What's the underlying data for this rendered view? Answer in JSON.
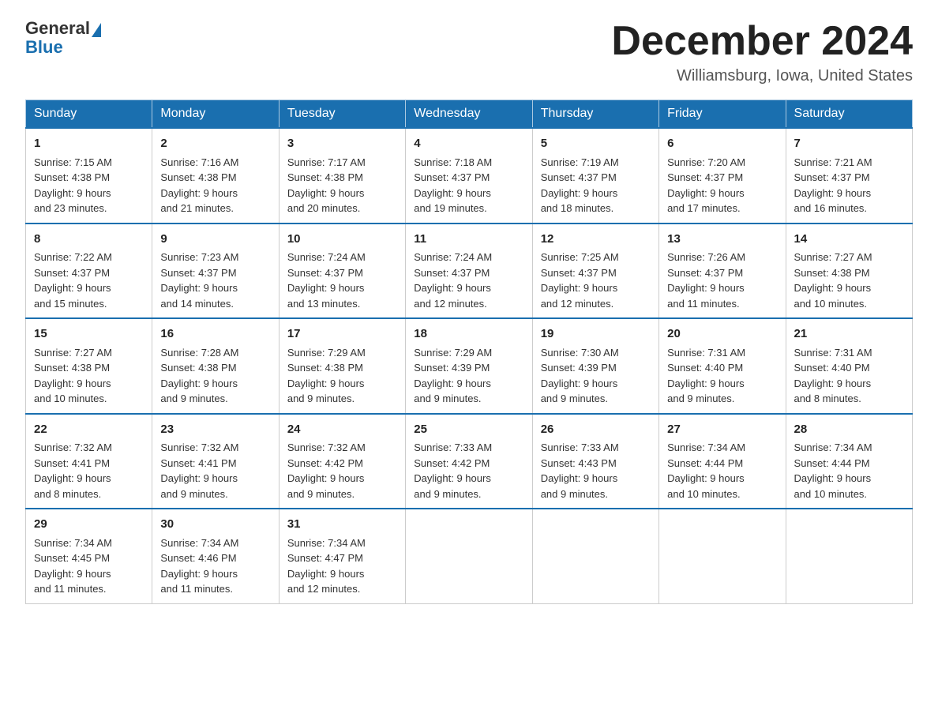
{
  "logo": {
    "general": "General",
    "blue": "Blue"
  },
  "header": {
    "month_year": "December 2024",
    "location": "Williamsburg, Iowa, United States"
  },
  "weekdays": [
    "Sunday",
    "Monday",
    "Tuesday",
    "Wednesday",
    "Thursday",
    "Friday",
    "Saturday"
  ],
  "weeks": [
    [
      {
        "day": "1",
        "sunrise": "7:15 AM",
        "sunset": "4:38 PM",
        "daylight": "9 hours and 23 minutes."
      },
      {
        "day": "2",
        "sunrise": "7:16 AM",
        "sunset": "4:38 PM",
        "daylight": "9 hours and 21 minutes."
      },
      {
        "day": "3",
        "sunrise": "7:17 AM",
        "sunset": "4:38 PM",
        "daylight": "9 hours and 20 minutes."
      },
      {
        "day": "4",
        "sunrise": "7:18 AM",
        "sunset": "4:37 PM",
        "daylight": "9 hours and 19 minutes."
      },
      {
        "day": "5",
        "sunrise": "7:19 AM",
        "sunset": "4:37 PM",
        "daylight": "9 hours and 18 minutes."
      },
      {
        "day": "6",
        "sunrise": "7:20 AM",
        "sunset": "4:37 PM",
        "daylight": "9 hours and 17 minutes."
      },
      {
        "day": "7",
        "sunrise": "7:21 AM",
        "sunset": "4:37 PM",
        "daylight": "9 hours and 16 minutes."
      }
    ],
    [
      {
        "day": "8",
        "sunrise": "7:22 AM",
        "sunset": "4:37 PM",
        "daylight": "9 hours and 15 minutes."
      },
      {
        "day": "9",
        "sunrise": "7:23 AM",
        "sunset": "4:37 PM",
        "daylight": "9 hours and 14 minutes."
      },
      {
        "day": "10",
        "sunrise": "7:24 AM",
        "sunset": "4:37 PM",
        "daylight": "9 hours and 13 minutes."
      },
      {
        "day": "11",
        "sunrise": "7:24 AM",
        "sunset": "4:37 PM",
        "daylight": "9 hours and 12 minutes."
      },
      {
        "day": "12",
        "sunrise": "7:25 AM",
        "sunset": "4:37 PM",
        "daylight": "9 hours and 12 minutes."
      },
      {
        "day": "13",
        "sunrise": "7:26 AM",
        "sunset": "4:37 PM",
        "daylight": "9 hours and 11 minutes."
      },
      {
        "day": "14",
        "sunrise": "7:27 AM",
        "sunset": "4:38 PM",
        "daylight": "9 hours and 10 minutes."
      }
    ],
    [
      {
        "day": "15",
        "sunrise": "7:27 AM",
        "sunset": "4:38 PM",
        "daylight": "9 hours and 10 minutes."
      },
      {
        "day": "16",
        "sunrise": "7:28 AM",
        "sunset": "4:38 PM",
        "daylight": "9 hours and 9 minutes."
      },
      {
        "day": "17",
        "sunrise": "7:29 AM",
        "sunset": "4:38 PM",
        "daylight": "9 hours and 9 minutes."
      },
      {
        "day": "18",
        "sunrise": "7:29 AM",
        "sunset": "4:39 PM",
        "daylight": "9 hours and 9 minutes."
      },
      {
        "day": "19",
        "sunrise": "7:30 AM",
        "sunset": "4:39 PM",
        "daylight": "9 hours and 9 minutes."
      },
      {
        "day": "20",
        "sunrise": "7:31 AM",
        "sunset": "4:40 PM",
        "daylight": "9 hours and 9 minutes."
      },
      {
        "day": "21",
        "sunrise": "7:31 AM",
        "sunset": "4:40 PM",
        "daylight": "9 hours and 8 minutes."
      }
    ],
    [
      {
        "day": "22",
        "sunrise": "7:32 AM",
        "sunset": "4:41 PM",
        "daylight": "9 hours and 8 minutes."
      },
      {
        "day": "23",
        "sunrise": "7:32 AM",
        "sunset": "4:41 PM",
        "daylight": "9 hours and 9 minutes."
      },
      {
        "day": "24",
        "sunrise": "7:32 AM",
        "sunset": "4:42 PM",
        "daylight": "9 hours and 9 minutes."
      },
      {
        "day": "25",
        "sunrise": "7:33 AM",
        "sunset": "4:42 PM",
        "daylight": "9 hours and 9 minutes."
      },
      {
        "day": "26",
        "sunrise": "7:33 AM",
        "sunset": "4:43 PM",
        "daylight": "9 hours and 9 minutes."
      },
      {
        "day": "27",
        "sunrise": "7:34 AM",
        "sunset": "4:44 PM",
        "daylight": "9 hours and 10 minutes."
      },
      {
        "day": "28",
        "sunrise": "7:34 AM",
        "sunset": "4:44 PM",
        "daylight": "9 hours and 10 minutes."
      }
    ],
    [
      {
        "day": "29",
        "sunrise": "7:34 AM",
        "sunset": "4:45 PM",
        "daylight": "9 hours and 11 minutes."
      },
      {
        "day": "30",
        "sunrise": "7:34 AM",
        "sunset": "4:46 PM",
        "daylight": "9 hours and 11 minutes."
      },
      {
        "day": "31",
        "sunrise": "7:34 AM",
        "sunset": "4:47 PM",
        "daylight": "9 hours and 12 minutes."
      },
      null,
      null,
      null,
      null
    ]
  ],
  "labels": {
    "sunrise": "Sunrise:",
    "sunset": "Sunset:",
    "daylight": "Daylight:"
  }
}
